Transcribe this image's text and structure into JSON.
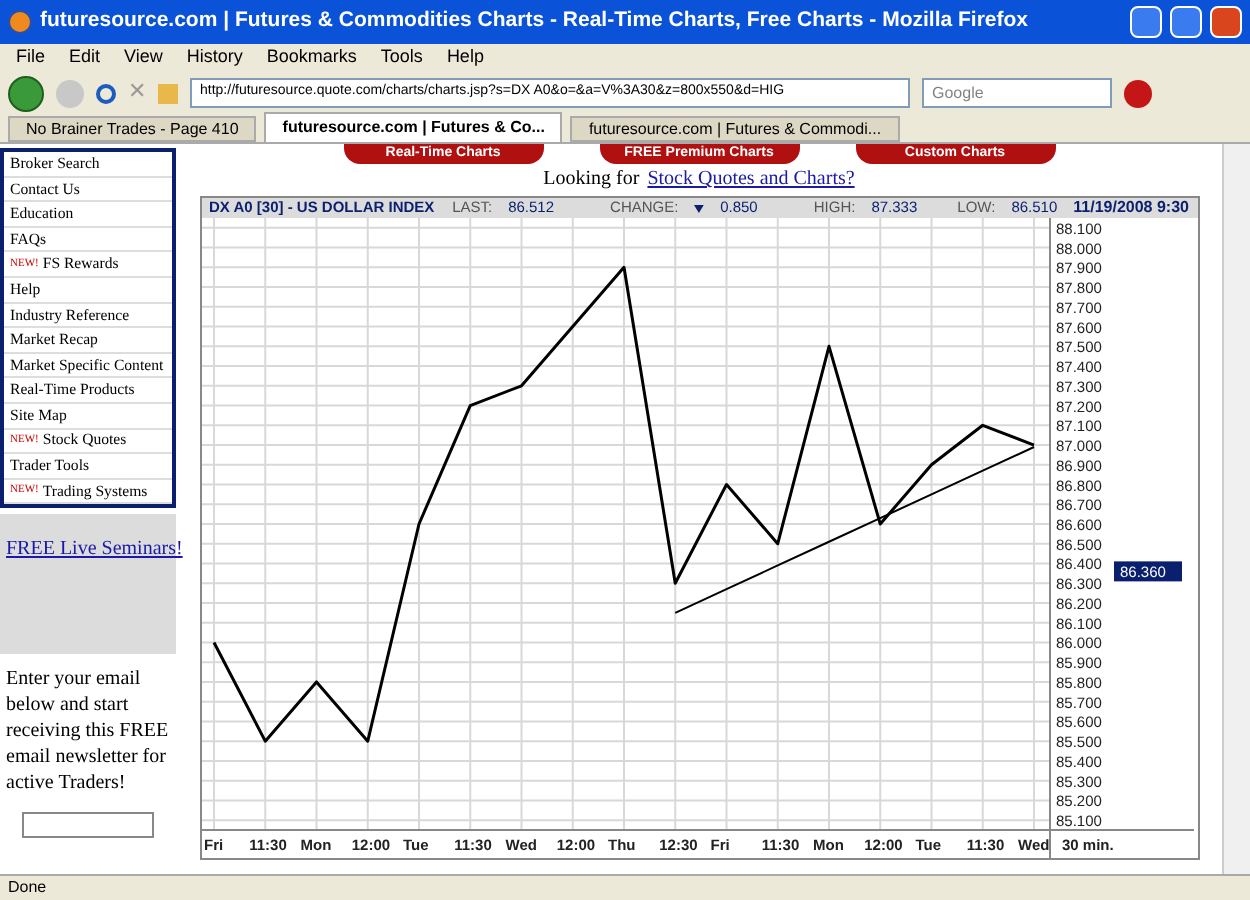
{
  "window": {
    "title": "futuresource.com | Futures & Commodities Charts - Real-Time Charts, Free Charts - Mozilla Firefox"
  },
  "menu": [
    "File",
    "Edit",
    "View",
    "History",
    "Bookmarks",
    "Tools",
    "Help"
  ],
  "toolbar": {
    "stop_glyph": "✕"
  },
  "address": {
    "value": "http://futuresource.quote.com/charts/charts.jsp?s=DX A0&o=&a=V%3A30&z=800x550&d=HIG"
  },
  "search": {
    "placeholder": "Google"
  },
  "tabs": [
    {
      "label": "No Brainer Trades - Page 410",
      "selected": false
    },
    {
      "label": "futuresource.com | Futures & Co...",
      "selected": true
    },
    {
      "label": "futuresource.com | Futures & Commodi...",
      "selected": false
    }
  ],
  "sidebar": {
    "items": [
      {
        "label": "Broker Search"
      },
      {
        "label": "Contact Us"
      },
      {
        "label": "Education"
      },
      {
        "label": "FAQs"
      },
      {
        "label": "FS Rewards",
        "badge": "NEW!"
      },
      {
        "label": "Help"
      },
      {
        "label": "Industry Reference"
      },
      {
        "label": "Market Recap"
      },
      {
        "label": "Market Specific Content"
      },
      {
        "label": "Real-Time Products"
      },
      {
        "label": "Site Map"
      },
      {
        "label": "Stock Quotes",
        "badge": "NEW!"
      },
      {
        "label": "Trader Tools"
      },
      {
        "label": "Trading Systems",
        "badge": "NEW!"
      }
    ],
    "seminar_link": "FREE Live Seminars!",
    "newsletter_text": "Enter your email below and start receiving this FREE email newsletter for active Traders!"
  },
  "top_buttons": [
    "Real-Time Charts",
    "FREE Premium Charts",
    "Custom Charts"
  ],
  "looking_for": {
    "text": "Looking for",
    "link": "Stock Quotes and Charts?"
  },
  "chart": {
    "symbol": "DX A0 [30] - US DOLLAR INDEX",
    "last_label": "LAST:",
    "last": "86.512",
    "change_label": "CHANGE:",
    "change": "0.850",
    "change_down": true,
    "high_label": "HIGH:",
    "high": "87.333",
    "low_label": "LOW:",
    "low": "86.510",
    "datetime": "11/19/2008 9:30",
    "current_price_label": "86.360",
    "interval_label": "30 min.",
    "chart_data": {
      "type": "line",
      "grid": true,
      "categories": [
        "Fri",
        "11:30",
        "Mon",
        "12:00",
        "Tue",
        "11:30",
        "Wed",
        "12:00",
        "Thu",
        "12:30",
        "Fri",
        "11:30",
        "Mon",
        "12:00",
        "Tue",
        "11:30",
        "Wed"
      ],
      "series": [
        {
          "color": "#000000",
          "values": [
            86.0,
            85.5,
            85.8,
            85.5,
            86.6,
            87.2,
            87.3,
            87.6,
            87.9,
            86.3,
            86.8,
            86.5,
            87.5,
            86.6,
            86.9,
            87.1,
            87.0
          ]
        },
        {
          "color": "#000000",
          "values": [
            null,
            null,
            null,
            null,
            null,
            null,
            null,
            null,
            null,
            86.15,
            86.27,
            86.39,
            86.51,
            86.63,
            86.75,
            86.87,
            86.99
          ]
        }
      ],
      "ylim": [
        85.05,
        88.15
      ],
      "yticks": [
        {
          "value": 85.1,
          "label": "85.100"
        },
        {
          "value": 85.2,
          "label": "85.200"
        },
        {
          "value": 85.3,
          "label": "85.300"
        },
        {
          "value": 85.4,
          "label": "85.400"
        },
        {
          "value": 85.5,
          "label": "85.500"
        },
        {
          "value": 85.6,
          "label": "85.600"
        },
        {
          "value": 85.7,
          "label": "85.700"
        },
        {
          "value": 85.8,
          "label": "85.800"
        },
        {
          "value": 85.9,
          "label": "85.900"
        },
        {
          "value": 86.0,
          "label": "86.000"
        },
        {
          "value": 86.1,
          "label": "86.100"
        },
        {
          "value": 86.2,
          "label": "86.200"
        },
        {
          "value": 86.3,
          "label": "86.300"
        },
        {
          "value": 86.4,
          "label": "86.400"
        },
        {
          "value": 86.5,
          "label": "86.500"
        },
        {
          "value": 86.6,
          "label": "86.600"
        },
        {
          "value": 86.7,
          "label": "86.700"
        },
        {
          "value": 86.8,
          "label": "86.800"
        },
        {
          "value": 86.9,
          "label": "86.900"
        },
        {
          "value": 87.0,
          "label": "87.000"
        },
        {
          "value": 87.1,
          "label": "87.100"
        },
        {
          "value": 87.2,
          "label": "87.200"
        },
        {
          "value": 87.3,
          "label": "87.300"
        },
        {
          "value": 87.4,
          "label": "87.400"
        },
        {
          "value": 87.5,
          "label": "87.500"
        },
        {
          "value": 87.6,
          "label": "87.600"
        },
        {
          "value": 87.7,
          "label": "87.700"
        },
        {
          "value": 87.8,
          "label": "87.800"
        },
        {
          "value": 87.9,
          "label": "87.900"
        },
        {
          "value": 88.0,
          "label": "88.000"
        },
        {
          "value": 88.1,
          "label": "88.100"
        }
      ]
    }
  },
  "status_bar": "Done"
}
